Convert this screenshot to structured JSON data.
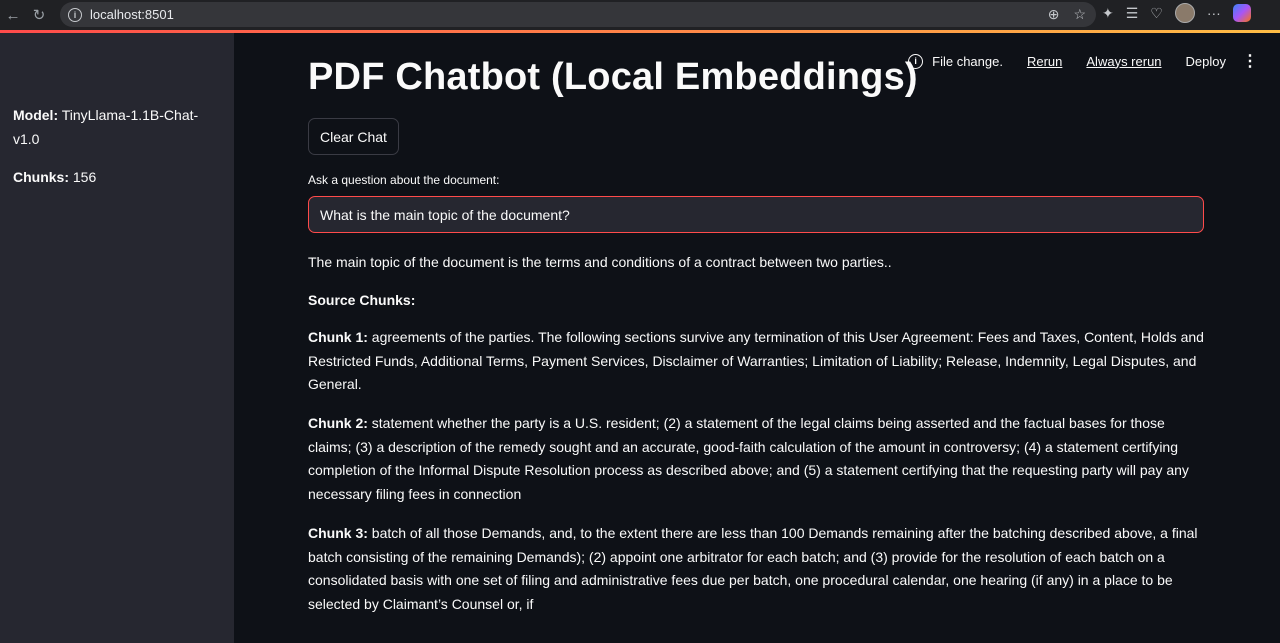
{
  "browser": {
    "url": "localhost:8501"
  },
  "sidebar": {
    "model_label": "Model:",
    "model_value": "TinyLlama-1.1B-Chat-v1.0",
    "chunks_label": "Chunks:",
    "chunks_value": "156"
  },
  "toolbar": {
    "status": "File change.",
    "rerun": "Rerun",
    "always_rerun": "Always rerun",
    "deploy": "Deploy"
  },
  "main": {
    "title": "PDF Chatbot (Local Embeddings)",
    "clear_button": "Clear Chat",
    "question_label": "Ask a question about the document:",
    "question_value": "What is the main topic of the document?",
    "answer": "The main topic of the document is the terms and conditions of a contract between two parties..",
    "sources_heading": "Source Chunks:",
    "chunks": [
      {
        "label": "Chunk 1:",
        "text": "agreements of the parties. The following sections survive any termination of this User Agreement: Fees and Taxes, Content, Holds and Restricted Funds, Additional Terms, Payment Services, Disclaimer of Warranties; Limitation of Liability; Release, Indemnity, Legal Disputes, and General."
      },
      {
        "label": "Chunk 2:",
        "text": "statement whether the party is a U.S. resident; (2) a statement of the legal claims being asserted and the factual bases for those claims; (3) a description of the remedy sought and an accurate, good-faith calculation of the amount in controversy; (4) a statement certifying completion of the Informal Dispute Resolution process as described above; and (5) a statement certifying that the requesting party will pay any necessary filing fees in connection"
      },
      {
        "label": "Chunk 3:",
        "text": "batch of all those Demands, and, to the extent there are less than 100 Demands remaining after the batching described above, a final batch consisting of the remaining Demands); (2) appoint one arbitrator for each batch; and (3) provide for the resolution of each batch on a consolidated basis with one set of filing and administrative fees due per batch, one procedural calendar, one hearing (if any) in a place to be selected by Claimant’s Counsel or, if"
      }
    ]
  }
}
